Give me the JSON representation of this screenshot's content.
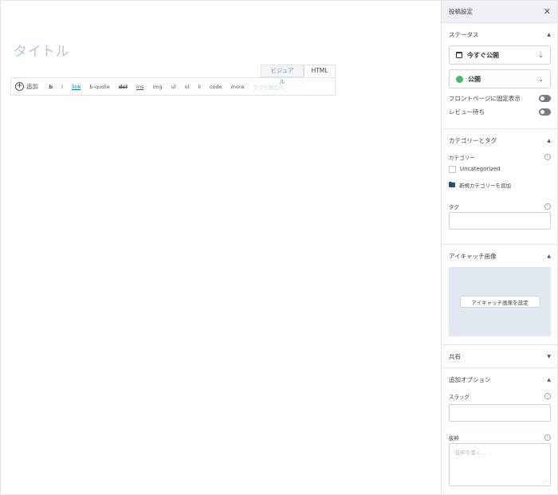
{
  "editor": {
    "title_placeholder": "タイトル",
    "tabs": {
      "visual": "ビジュアル",
      "html": "HTML"
    },
    "toolbar": {
      "add": "追加",
      "buttons": [
        "b",
        "i",
        "link",
        "b-quote",
        "del",
        "ins",
        "img",
        "ul",
        "ol",
        "li",
        "code",
        "more",
        "タグを閉じる"
      ]
    }
  },
  "sidebar": {
    "title": "投稿設定",
    "status": {
      "heading": "ステータス",
      "schedule": "今すぐ公開",
      "visibility": "公開",
      "sticky_label": "フロントページに固定表示",
      "pending_label": "レビュー待ち"
    },
    "categories": {
      "heading": "カテゴリーとタグ",
      "category_label": "カテゴリー",
      "category_item": "Uncategorized",
      "add_category": "新規カテゴリーを追加",
      "tag_label": "タグ"
    },
    "featured": {
      "heading": "アイキャッチ画像",
      "button": "アイキャッチ画像を設定"
    },
    "share": {
      "heading": "共有"
    },
    "extra": {
      "heading": "追加オプション",
      "slug_label": "スラッグ",
      "excerpt_label": "抜粋",
      "excerpt_placeholder": "抜粋を書く..."
    }
  }
}
